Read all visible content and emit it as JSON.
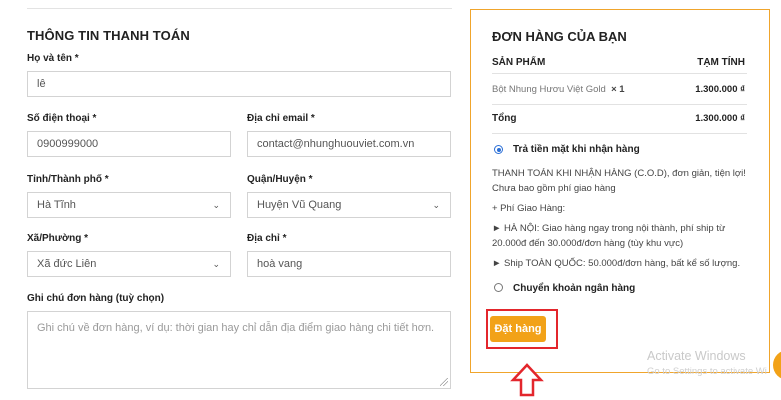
{
  "billing": {
    "title": "THÔNG TIN THANH TOÁN",
    "name_label": "Họ và tên *",
    "name_value": "lê",
    "phone_label": "Số điện thoại *",
    "phone_value": "0900999000",
    "email_label": "Địa chỉ email *",
    "email_value": "contact@nhunghuouviet.com.vn",
    "province_label": "Tỉnh/Thành phố *",
    "province_value": "Hà Tĩnh",
    "district_label": "Quận/Huyện *",
    "district_value": "Huyện Vũ Quang",
    "ward_label": "Xã/Phường *",
    "ward_value": "Xã đức Liên",
    "address_label": "Địa chỉ *",
    "address_value": "hoà vang",
    "notes_label": "Ghi chú đơn hàng (tuỳ chọn)",
    "notes_placeholder": "Ghi chú về đơn hàng, ví dụ: thời gian hay chỉ dẫn địa điểm giao hàng chi tiết hơn."
  },
  "order": {
    "title": "ĐƠN HÀNG CỦA BẠN",
    "col_product": "SẢN PHẨM",
    "col_subtotal": "TẠM TÍNH",
    "product_name": "Bột Nhung Hươu Việt Gold",
    "product_qty": "× 1",
    "product_price": "1.300.000 ₫",
    "total_label": "Tổng",
    "total_value": "1.300.000 ₫",
    "payment_cod_label": "Trả tiền mặt khi nhận hàng",
    "cod_desc_1": "THANH TOÁN KHI NHẬN HÀNG (C.O.D), đơn giản, tiện lợi! Chưa bao gồm phí giao hàng",
    "cod_desc_2": "+ Phí Giao Hàng:",
    "cod_desc_3": "► HÀ NỘI: Giao hàng ngay trong nội thành, phí ship từ 20.000đ đến 30.000đ/đơn hàng (tùy khu vực)",
    "cod_desc_4": "► Ship TOÀN QUỐC: 50.000đ/đơn hàng, bất kể số lượng.",
    "payment_bank_label": "Chuyển khoản ngân hàng",
    "place_order_label": "Đặt hàng"
  },
  "watermark": {
    "line1": "Activate Windows",
    "line2": "Go to Settings to activate Wi"
  },
  "colors": {
    "accent": "#f2a218",
    "highlight": "#e3262c",
    "radio": "#2b6fd6"
  },
  "icons": {
    "select_chevron": "chevron-down-icon",
    "annotation_arrow": "arrow-up-icon"
  }
}
